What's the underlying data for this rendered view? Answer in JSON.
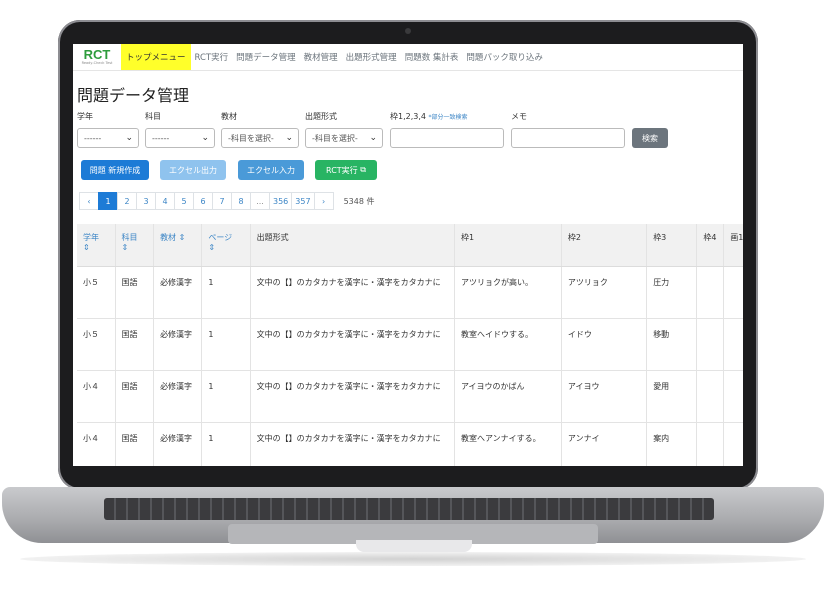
{
  "nav": {
    "logo": "RCT",
    "logo_sub": "Ready-Check Test",
    "items": [
      "トップメニュー",
      "RCT実行",
      "問題データ管理",
      "教材管理",
      "出題形式管理",
      "問題数 集計表",
      "問題パック取り込み"
    ]
  },
  "page_title": "問題データ管理",
  "filters": {
    "grade_label": "学年",
    "subject_label": "科目",
    "material_label": "教材",
    "format_label": "出題形式",
    "frame_label": "枠1,2,3,4",
    "frame_note": "*部分一致検索",
    "memo_label": "メモ",
    "grade_value": "------",
    "subject_value": "------",
    "material_value": "-科目を選択-",
    "format_value": "-科目を選択-",
    "search_button": "検索"
  },
  "actions": {
    "new": "問題 新規作成",
    "excel_out": "エクセル出力",
    "excel_in": "エクセル入力",
    "rct_run": "RCT実行"
  },
  "pagination": {
    "prev": "‹",
    "pages": [
      "1",
      "2",
      "3",
      "4",
      "5",
      "6",
      "7",
      "8",
      "...",
      "356",
      "357"
    ],
    "next": "›",
    "total": "5348 件"
  },
  "table": {
    "headers": [
      "学年",
      "科目",
      "教材",
      "ページ",
      "出題形式",
      "枠1",
      "枠2",
      "枠3",
      "枠4",
      "画1"
    ],
    "sort_icon": "⇕",
    "rows": [
      [
        "小５",
        "国語",
        "必修漢字",
        "1",
        "文中の【】のカタカナを漢字に・漢字をカタカナに",
        "アツリョクが高い。",
        "アツリョク",
        "圧力"
      ],
      [
        "小５",
        "国語",
        "必修漢字",
        "1",
        "文中の【】のカタカナを漢字に・漢字をカタカナに",
        "教室へイドウする。",
        "イドウ",
        "移動"
      ],
      [
        "小４",
        "国語",
        "必修漢字",
        "1",
        "文中の【】のカタカナを漢字に・漢字をカタカナに",
        "アイヨウのかばん",
        "アイヨウ",
        "愛用"
      ],
      [
        "小４",
        "国語",
        "必修漢字",
        "1",
        "文中の【】のカタカナを漢字に・漢字をカタカナに",
        "教室へアンナイする。",
        "アンナイ",
        "案内"
      ]
    ]
  },
  "colors": {
    "accent_blue": "#1d7bd6",
    "nav_active": "#ffff2a",
    "green": "#28b463",
    "disabled_blue": "#8fc3ee",
    "teal_blue": "#4a9ad8",
    "logo_green": "#2e9c3c"
  }
}
